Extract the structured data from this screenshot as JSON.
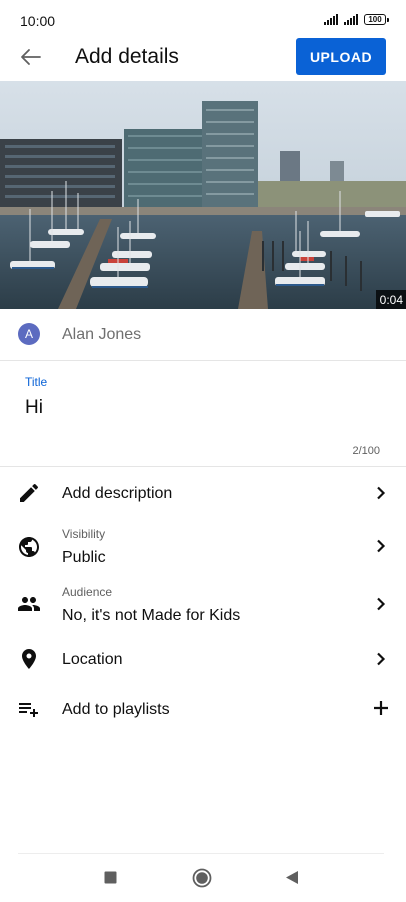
{
  "status_bar": {
    "time": "10:00",
    "battery": "100"
  },
  "header": {
    "title": "Add details",
    "upload_label": "UPLOAD"
  },
  "video": {
    "duration": "0:04"
  },
  "channel": {
    "avatar_letter": "A",
    "name": "Alan Jones"
  },
  "title_field": {
    "label": "Title",
    "value": "Hi",
    "counter": "2/100"
  },
  "menu": {
    "description": {
      "label": "Add description",
      "icon": "pencil-icon"
    },
    "visibility": {
      "caption": "Visibility",
      "value": "Public",
      "icon": "globe-icon"
    },
    "audience": {
      "caption": "Audience",
      "value": "No, it's not Made for Kids",
      "icon": "people-icon"
    },
    "location": {
      "label": "Location",
      "icon": "location-pin-icon"
    },
    "playlists": {
      "label": "Add to playlists",
      "icon": "playlist-add-icon"
    }
  },
  "colors": {
    "accent": "#0a62d6",
    "avatar": "#5c6bc0"
  }
}
